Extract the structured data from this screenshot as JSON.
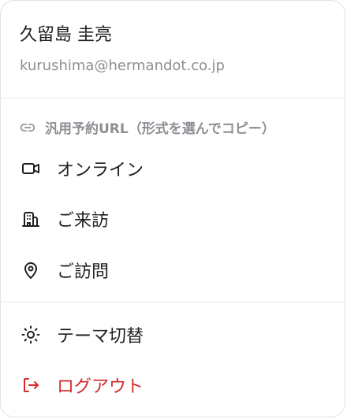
{
  "user": {
    "name": "久留島 圭亮",
    "email": "kurushima@hermandot.co.jp"
  },
  "booking_section": {
    "label": "汎用予約URL（形式を選んでコピー）",
    "icon": "link-icon"
  },
  "booking_options": [
    {
      "label": "オンライン",
      "icon": "video-camera-icon"
    },
    {
      "label": "ご来訪",
      "icon": "building-icon"
    },
    {
      "label": "ご訪問",
      "icon": "map-pin-icon"
    }
  ],
  "settings": [
    {
      "label": "テーマ切替",
      "icon": "sun-icon"
    },
    {
      "label": "ログアウト",
      "icon": "logout-icon"
    }
  ],
  "colors": {
    "text": "#1f1f22",
    "muted": "#8e8f94",
    "danger": "#d42b2b",
    "border": "#e2e2e4"
  }
}
